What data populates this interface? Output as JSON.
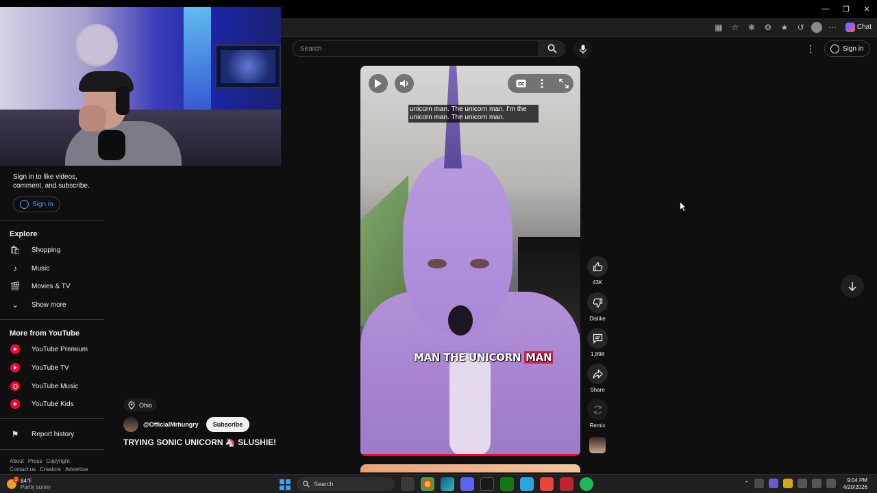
{
  "browser": {
    "chat_label": "Chat"
  },
  "webcam": {
    "label": "streamer webcam"
  },
  "sidebar": {
    "signin_prompt": "Sign in to like videos, comment, and subscribe.",
    "signin_label": "Sign in",
    "explore_heading": "Explore",
    "explore_items": [
      {
        "label": "Shopping",
        "icon": "shopping-bag-icon"
      },
      {
        "label": "Music",
        "icon": "music-note-icon"
      },
      {
        "label": "Movies & TV",
        "icon": "clapperboard-icon"
      },
      {
        "label": "Show more",
        "icon": "chevron-down-icon"
      }
    ],
    "more_heading": "More from YouTube",
    "more_items": [
      {
        "label": "YouTube Premium",
        "icon": "youtube-premium-icon"
      },
      {
        "label": "YouTube TV",
        "icon": "youtube-tv-icon"
      },
      {
        "label": "YouTube Music",
        "icon": "youtube-music-icon"
      },
      {
        "label": "YouTube Kids",
        "icon": "youtube-kids-icon"
      }
    ],
    "report_history_label": "Report history",
    "footer_row1": [
      "About",
      "Press",
      "Copyright"
    ],
    "footer_row2": [
      "Contact us",
      "Creators",
      "Advertise"
    ]
  },
  "header": {
    "search_placeholder": "Search",
    "signin_label": "Sign in"
  },
  "player": {
    "caption_top": "unicorn man. The unicorn man. I'm the unicorn man. The unicorn man.",
    "caption_big_prefix": "MAN THE UNICORN ",
    "caption_big_highlight": "MAN",
    "progress_fraction": 1.0
  },
  "actions": {
    "likes": "43K",
    "dislike_label": "Dislike",
    "comments": "1,898",
    "share_label": "Share",
    "remix_label": "Remix"
  },
  "video_info": {
    "location": "Ohio",
    "channel": "@OfficialMrhungry",
    "subscribe_label": "Subscribe",
    "title": "TRYING SONIC UNICORN 🦄 SLUSHIE!"
  },
  "taskbar": {
    "weather_temp": "84°F",
    "weather_desc": "Partly sunny",
    "search_label": "Search",
    "time": "9:04 PM",
    "date": "4/20/2026"
  },
  "colors": {
    "background": "#0f0f0f",
    "accent_blue": "#3ea6ff",
    "youtube_red": "#ff0033",
    "caption_highlight": "#d6234a"
  }
}
